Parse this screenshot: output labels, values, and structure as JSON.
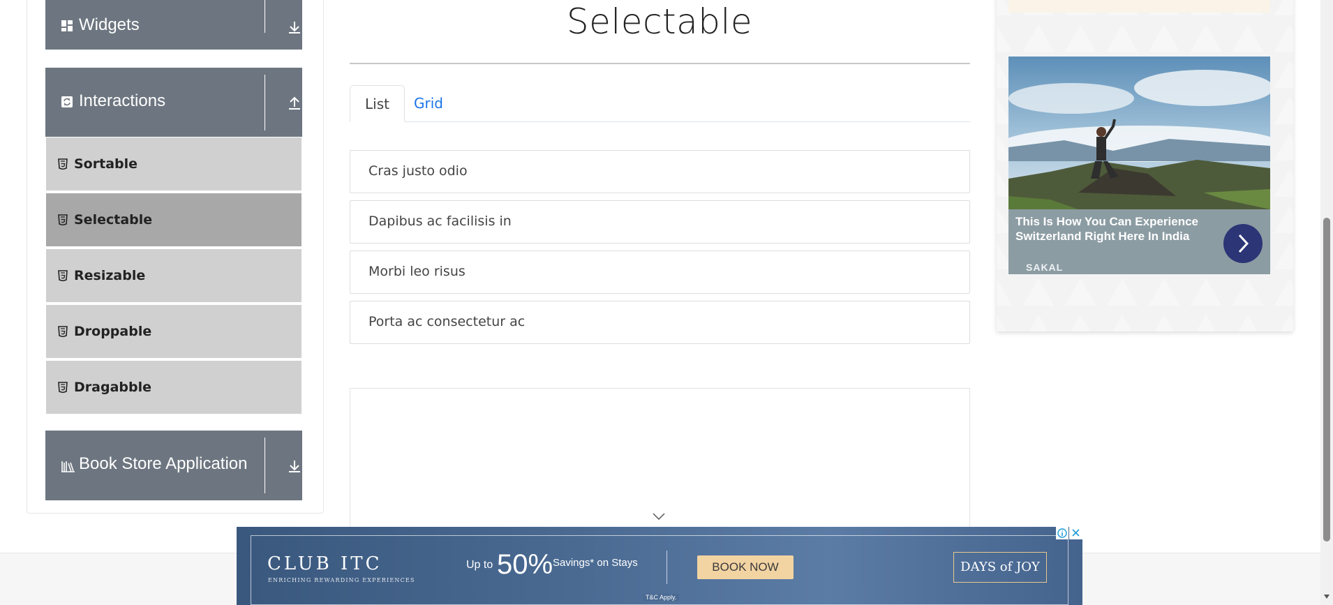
{
  "sidebar": {
    "groups": {
      "widgets": {
        "label": "Widgets",
        "icon": "widgets-grid-icon",
        "arrow": "download-arrow-icon"
      },
      "interactions": {
        "label": "Interactions",
        "icon": "interactions-icon",
        "arrow": "upload-arrow-icon"
      },
      "bookstore": {
        "label": "Book Store Application",
        "icon": "books-icon",
        "arrow": "download-arrow-icon"
      }
    },
    "items": [
      {
        "label": "Sortable",
        "active": false
      },
      {
        "label": "Selectable",
        "active": true
      },
      {
        "label": "Resizable",
        "active": false
      },
      {
        "label": "Droppable",
        "active": false
      },
      {
        "label": "Dragabble",
        "active": false
      }
    ]
  },
  "main": {
    "title": "Selectable",
    "tabs": [
      {
        "label": "List",
        "active": true
      },
      {
        "label": "Grid",
        "active": false
      }
    ],
    "list_items": [
      "Cras justo odio",
      "Dapibus ac facilisis in",
      "Morbi leo risus",
      "Porta ac consectetur ac"
    ]
  },
  "right_ad": {
    "headline": "This Is How You Can Experience Switzerland Right Here In India",
    "source": "SAKAL"
  },
  "bottom_ad": {
    "brand": "CLUB ITC",
    "brand_sub": "ENRICHING REWARDING EXPERIENCES",
    "offer_prefix": "Up to",
    "offer_value": "50%",
    "offer_suffix": "Savings* on Stays",
    "cta": "BOOK NOW",
    "campaign": "DAYS of JOY",
    "terms": "T&C Apply."
  },
  "colors": {
    "sidebar_header": "#6d7680",
    "menu_item": "#d0d0d0",
    "menu_item_active": "#a8a8a8",
    "link_blue": "#1a73e8",
    "ad_button": "#2c3576"
  }
}
